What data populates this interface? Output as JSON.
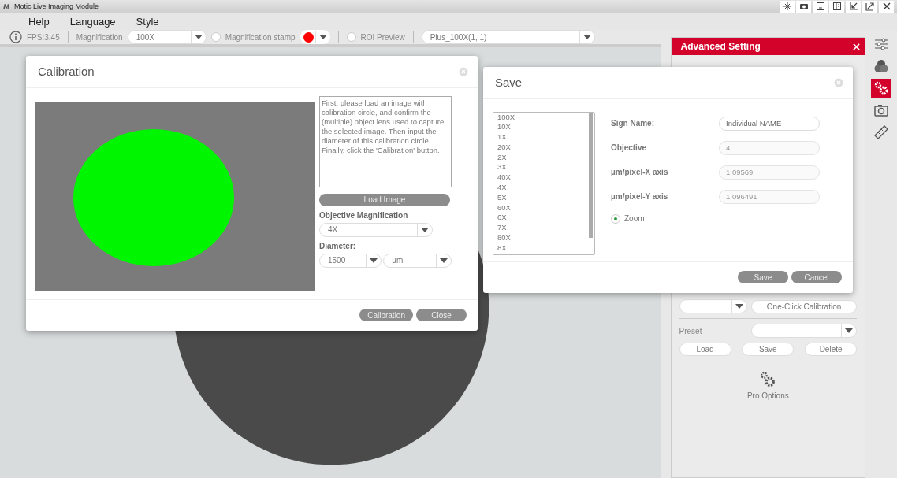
{
  "window": {
    "title": "Motic Live Imaging Module"
  },
  "menu": [
    "Help",
    "Language",
    "Style"
  ],
  "toolbar": {
    "fps": "FPS:3.45",
    "magnification_label": "Magnification",
    "magnification_value": "100X",
    "stamp": {
      "label": "Magnification stamp",
      "checked": false,
      "color": "#ff0000"
    },
    "roi_preview": {
      "label": "ROI Preview",
      "checked": false
    },
    "preset_value": "Plus_100X(1, 1)"
  },
  "advanced_panel": {
    "title": "Advanced Setting",
    "calibration_button": "One-Click Calibration",
    "preset_label": "Preset",
    "preset_buttons": [
      "Load",
      "Save",
      "Delete"
    ],
    "pro_options": "Pro Options"
  },
  "side_tools": [
    {
      "kind": "sliders",
      "selected": false
    },
    {
      "kind": "colors",
      "selected": false
    },
    {
      "kind": "gears",
      "selected": true
    },
    {
      "kind": "camera",
      "selected": false
    },
    {
      "kind": "ruler",
      "selected": false
    }
  ],
  "calibration_dialog": {
    "title": "Calibration",
    "instructions": "First, please load an image with calibration circle, and confirm the (multiple) object lens used to capture the selected image. Then input the diameter of this calibration circle. Finally, click the 'Calibration' button.",
    "load_button": "Load Image",
    "objective_label": "Objective Magnification",
    "objective_value": "4X",
    "diameter_label": "Diameter:",
    "diameter_value": "1500",
    "unit_value": "µm",
    "buttons": [
      "Calibration",
      "Close"
    ]
  },
  "save_dialog": {
    "title": "Save",
    "objectives": [
      "100X",
      "10X",
      "1X",
      "20X",
      "2X",
      "3X",
      "40X",
      "4X",
      "5X",
      "60X",
      "6X",
      "7X",
      "80X",
      "8X"
    ],
    "fields": [
      {
        "label": "Sign Name:",
        "value": "Individual NAME",
        "disabled": false
      },
      {
        "label": "Objective",
        "value": "4",
        "disabled": true
      },
      {
        "label": "µm/pixel-X axis",
        "value": "1.09569",
        "disabled": true
      },
      {
        "label": "µm/pixel-Y axis",
        "value": "1.096491",
        "disabled": true
      }
    ],
    "zoom": {
      "label": "Zoom",
      "checked": true
    },
    "buttons": [
      "Save",
      "Cancel"
    ]
  }
}
